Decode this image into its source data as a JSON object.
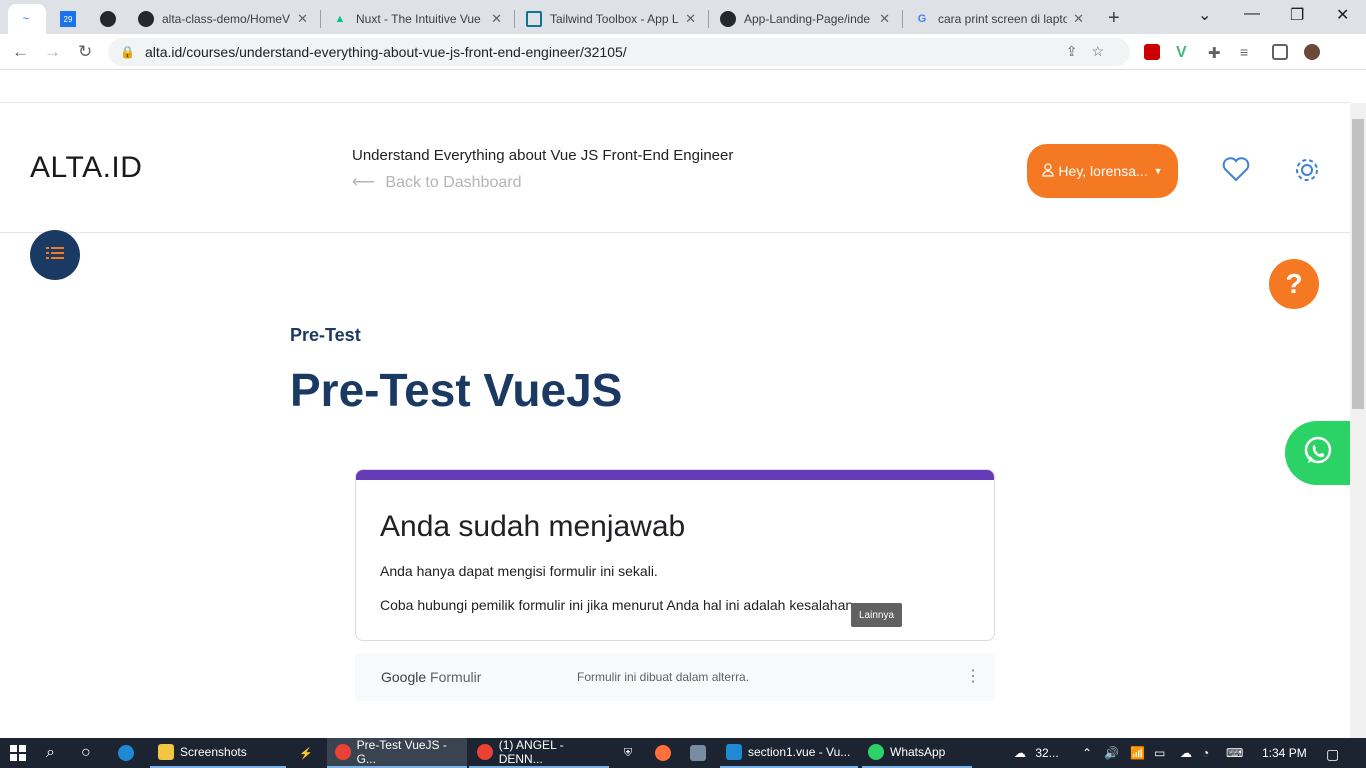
{
  "browser": {
    "tabs": [
      {
        "title": "",
        "icon": "app-icon",
        "active": true
      },
      {
        "title": "",
        "icon": "calendar-icon",
        "active": false
      },
      {
        "title": "",
        "icon": "github-icon",
        "active": false
      },
      {
        "title": "alta-class-demo/HomeV",
        "icon": "github-icon",
        "active": false
      },
      {
        "title": "Nuxt - The Intuitive Vue",
        "icon": "nuxt-icon",
        "active": false
      },
      {
        "title": "Tailwind Toolbox - App L",
        "icon": "tailwind-icon",
        "active": false
      },
      {
        "title": "App-Landing-Page/inde",
        "icon": "github-icon",
        "active": false
      },
      {
        "title": "cara print screen di lapto",
        "icon": "google-icon",
        "active": false
      }
    ],
    "new_tab_glyph": "+",
    "url": "alta.id/courses/understand-everything-about-vue-js-front-end-engineer/32105/"
  },
  "header": {
    "logo": "ALTA.ID",
    "course_title": "Understand Everything about Vue JS Front-End Engineer",
    "back_label": "Back to Dashboard",
    "user_label": "Hey, lorensa..."
  },
  "content": {
    "subtitle": "Pre-Test",
    "title": "Pre-Test VueJS"
  },
  "form": {
    "heading": "Anda sudah menjawab",
    "line1": "Anda hanya dapat mengisi formulir ini sekali.",
    "line2": "Coba hubungi pemilik formulir ini jika menurut Anda hal ini adalah kesalahan.",
    "tooltip": "Lainnya",
    "footer_brand_google": "Google",
    "footer_brand_formulir": " Formulir",
    "footer_note": "Formulir ini dibuat dalam alterra.",
    "accent_color": "#673ab7"
  },
  "colors": {
    "brand_orange": "#f47922",
    "brand_navy": "#1b3a63",
    "whatsapp_green": "#2bd366"
  },
  "taskbar": {
    "items": [
      {
        "label": "Screenshots",
        "icon": "folder-icon"
      },
      {
        "label": "Pre-Test VueJS - G...",
        "icon": "chrome-icon"
      },
      {
        "label": "(1) ANGEL - DENN...",
        "icon": "chrome-icon"
      },
      {
        "label": "section1.vue - Vu...",
        "icon": "vscode-icon"
      },
      {
        "label": "WhatsApp",
        "icon": "whatsapp-icon"
      }
    ],
    "weather": "32...",
    "clock": "1:34 PM"
  }
}
